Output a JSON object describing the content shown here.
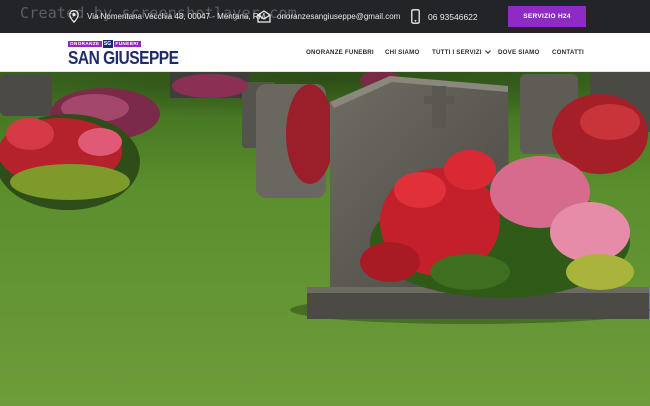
{
  "watermark": "Created by screenshotlayer.com",
  "topbar": {
    "address": "Via Nomentana Vecchia 48, 00047 - Mentana, RM",
    "email": "onoranzesangiuseppe@gmail.com",
    "phone": "06 93546622",
    "cta_label": "SERVIZIO H24",
    "icons": [
      "map-pin-icon",
      "email-icon",
      "smartphone-icon"
    ]
  },
  "logo": {
    "tag_left": "ONORANZE",
    "monogram": "SG",
    "tag_right": "FUNEBRI",
    "name": "SAN GIUSEPPE"
  },
  "nav": {
    "items": [
      {
        "label": "ONORANZE FUNEBRI"
      },
      {
        "label": "CHI SIAMO"
      },
      {
        "label": "TUTTI I SERVIZI",
        "has_dropdown": true
      },
      {
        "label": "DOVE SIAMO"
      },
      {
        "label": "CONTATTI"
      }
    ]
  },
  "colors": {
    "topbar_bg": "#232427",
    "accent_purple": "#8d2bc4",
    "brand_navy": "#1f2b6e",
    "nav_bg": "#ffffff",
    "nav_text": "#2b2b2b"
  }
}
